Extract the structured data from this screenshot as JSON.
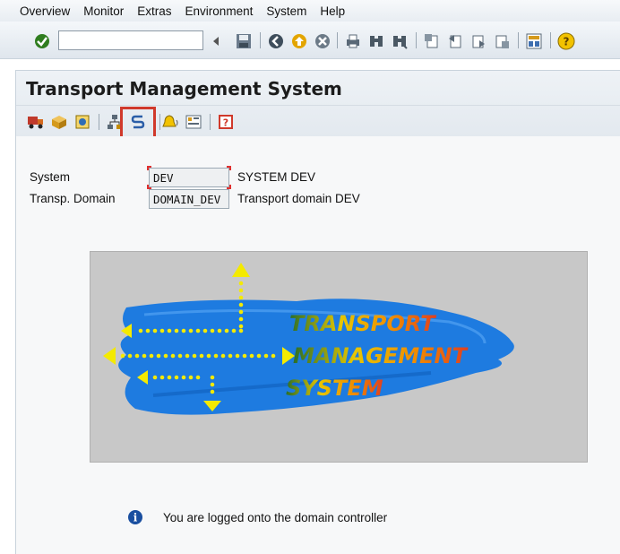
{
  "menu": {
    "items": [
      "Overview",
      "Monitor",
      "Extras",
      "Environment",
      "System",
      "Help"
    ]
  },
  "toolbar": {
    "command_field_value": "",
    "icons": [
      "enter-icon",
      "back-arrow-icon",
      "save-icon",
      "back-icon",
      "exit-icon",
      "cancel-icon",
      "print-icon",
      "find-icon",
      "find-next-icon",
      "first-page-icon",
      "previous-page-icon",
      "next-page-icon",
      "last-page-icon",
      "layout-icon",
      "help-icon"
    ]
  },
  "title": {
    "text": "Transport Management System"
  },
  "app_toolbar": {
    "icons": [
      "transport-truck-icon",
      "package-icon",
      "display-icon",
      "hierarchy-icon",
      "transport-routes-icon",
      "alert-bell-icon",
      "overview-icon",
      "help-book-icon"
    ]
  },
  "fields": {
    "system": {
      "label": "System",
      "value": "DEV",
      "description": "SYSTEM DEV"
    },
    "domain": {
      "label": "Transp. Domain",
      "value": "DOMAIN_DEV",
      "description": "Transport domain DEV"
    }
  },
  "logo": {
    "word1": "TRANSPORT",
    "word2": "MANAGEMENT",
    "word3": "SYSTEM"
  },
  "message": {
    "text": "You are logged onto the domain controller"
  },
  "colors": {
    "highlight": "#d0392b",
    "brush_blue": "#1e7be0",
    "arrow_yellow": "#f4ea00",
    "info_blue": "#1a4fa0"
  }
}
